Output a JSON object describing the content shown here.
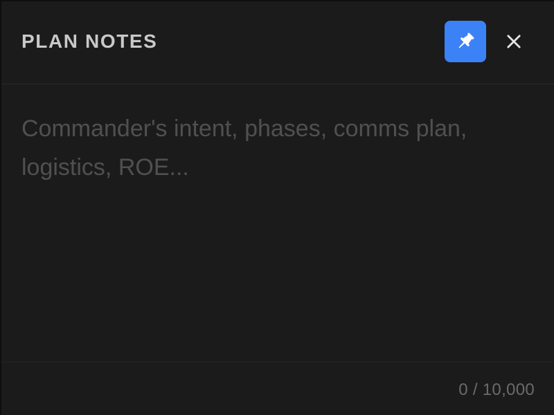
{
  "panel": {
    "title": "PLAN NOTES",
    "pin_icon": "pin-icon",
    "close_icon": "close-icon",
    "accent_color": "#3b82f6"
  },
  "notes": {
    "value": "",
    "placeholder": "Commander's intent, phases, comms plan, logistics, ROE..."
  },
  "footer": {
    "char_count": "0 / 10,000"
  }
}
